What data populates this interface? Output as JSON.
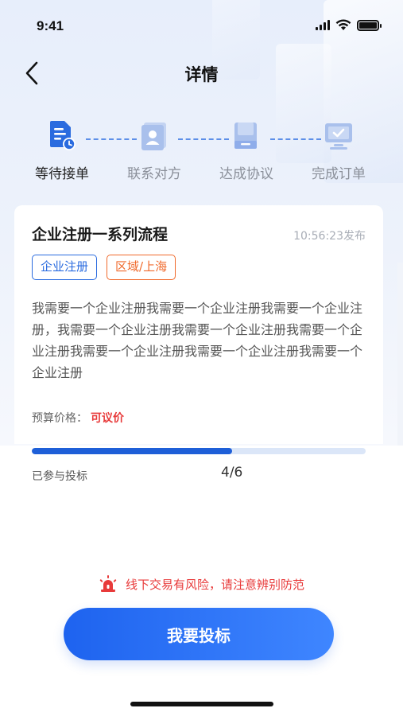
{
  "status_bar": {
    "time": "9:41"
  },
  "nav": {
    "title": "详情"
  },
  "steps": [
    {
      "label": "等待接单",
      "icon": "document-clock-icon",
      "active": true
    },
    {
      "label": "联系对方",
      "icon": "contact-card-icon",
      "active": false
    },
    {
      "label": "达成协议",
      "icon": "agreement-folder-icon",
      "active": false
    },
    {
      "label": "完成订单",
      "icon": "monitor-check-icon",
      "active": false
    }
  ],
  "card": {
    "title": "企业注册一系列流程",
    "time": "10:56:23发布",
    "tags": [
      {
        "label": "企业注册",
        "color": "#2a6bdf"
      },
      {
        "label": "区域/上海",
        "color": "#f06a2c"
      }
    ],
    "description": "我需要一个企业注册我需要一个企业注册我需要一个企业注册，我需要一个企业注册我需要一个企业注册我需要一个企业注册我需要一个企业注册我需要一个企业注册我需要一个企业注册",
    "budget_label": "预算价格：",
    "budget_value": "可议价"
  },
  "progress": {
    "label": "已参与投标",
    "count": "4/6",
    "fraction": 0.6
  },
  "warning": {
    "icon": "alarm-light-icon",
    "text": "线下交易有风险，请注意辨别防范"
  },
  "bid_button": {
    "label": "我要投标"
  },
  "colors": {
    "accent": "#1e63ef",
    "danger": "#e83a3a",
    "tag_orange": "#f06a2c"
  }
}
